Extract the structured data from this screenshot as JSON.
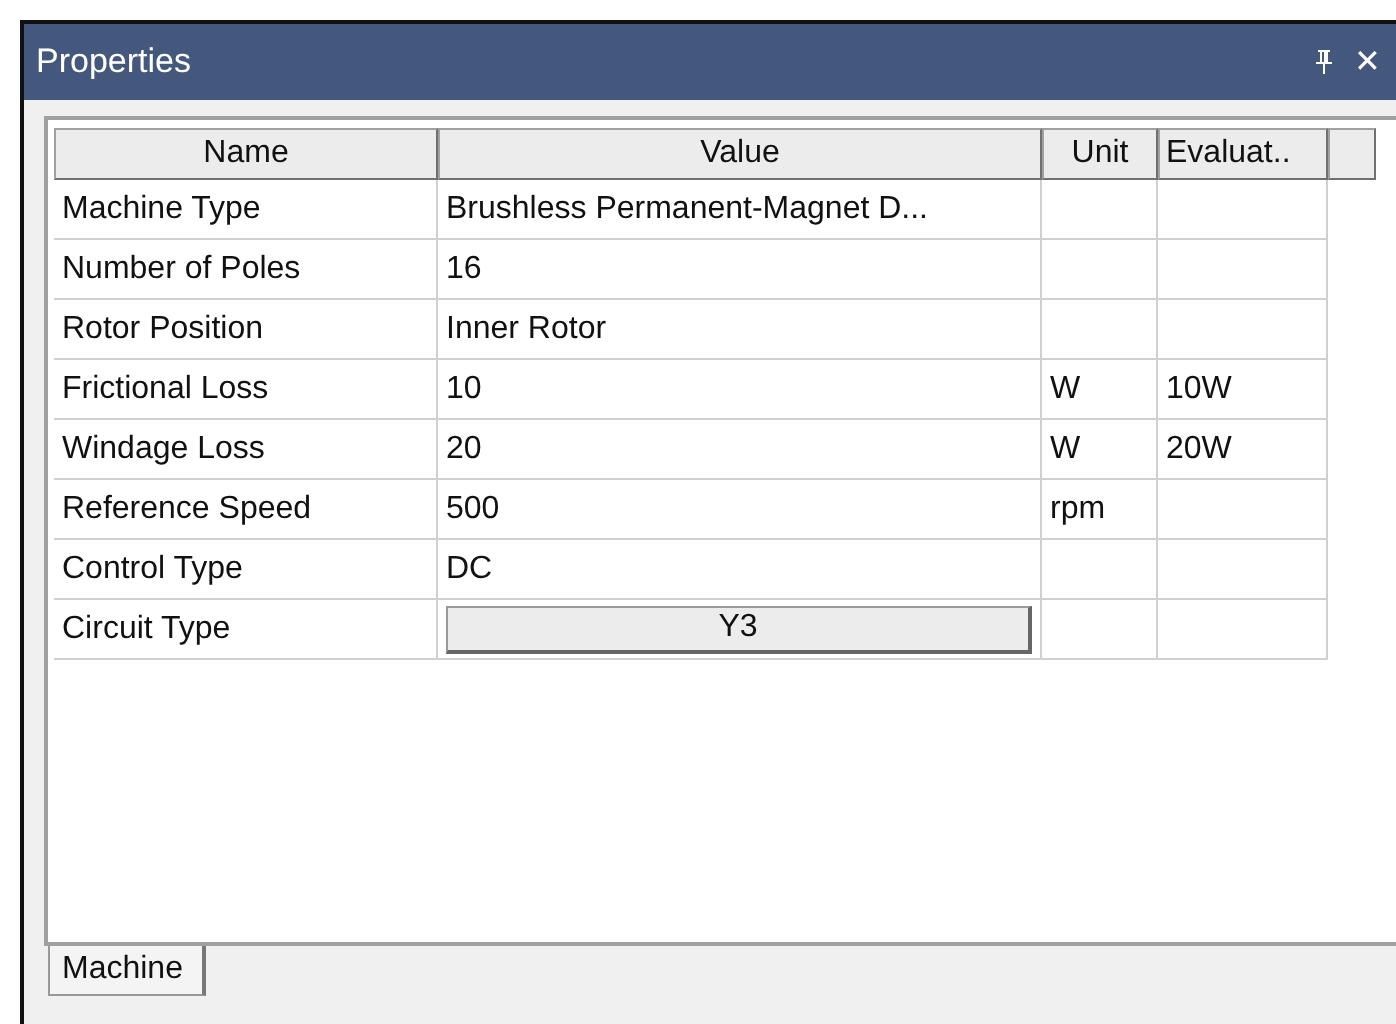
{
  "window": {
    "title": "Properties",
    "close_glyph": "✕"
  },
  "table": {
    "columns": [
      "Name",
      "Value",
      "Unit",
      "Evaluat.."
    ],
    "rows": [
      {
        "name": "Machine Type",
        "value": "Brushless Permanent-Magnet D...",
        "kind": "text",
        "unit": "",
        "evaluated": ""
      },
      {
        "name": "Number of Poles",
        "value": "16",
        "kind": "text",
        "unit": "",
        "evaluated": ""
      },
      {
        "name": "Rotor Position",
        "value": "Inner Rotor",
        "kind": "text",
        "unit": "",
        "evaluated": ""
      },
      {
        "name": "Frictional Loss",
        "value": "10",
        "kind": "text",
        "unit": "W",
        "evaluated": "10W"
      },
      {
        "name": "Windage Loss",
        "value": "20",
        "kind": "text",
        "unit": "W",
        "evaluated": "20W"
      },
      {
        "name": "Reference Speed",
        "value": "500",
        "kind": "text",
        "unit": "rpm",
        "evaluated": ""
      },
      {
        "name": "Control Type",
        "value": "DC",
        "kind": "text",
        "unit": "",
        "evaluated": ""
      },
      {
        "name": "Circuit Type",
        "value": "Y3",
        "kind": "button",
        "unit": "",
        "evaluated": ""
      }
    ]
  },
  "tabs": [
    {
      "label": "Machine",
      "selected": true
    }
  ]
}
